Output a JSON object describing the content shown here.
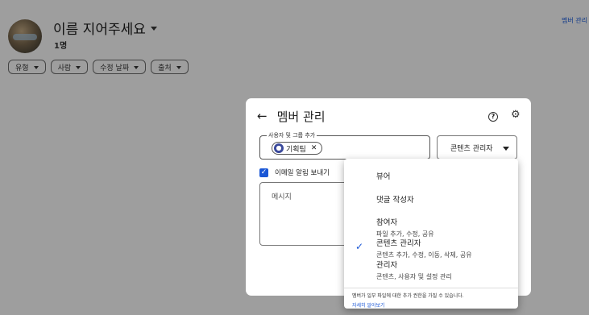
{
  "header": {
    "title": "이름 지어주세요",
    "count": "1명",
    "top_right_link": "멤버 관리"
  },
  "filters": [
    "유형",
    "사람",
    "수정 날짜",
    "출처"
  ],
  "dialog": {
    "title": "멤버 관리",
    "people_field_label": "사용자 및 그룹 추가",
    "person_chip": "기획팀",
    "role_value": "콘텐츠 관리자",
    "notify_label": "이메일 알림 보내기",
    "message_placeholder": "메시지"
  },
  "role_menu": {
    "items": [
      {
        "label": "뷰어",
        "desc": ""
      },
      {
        "label": "댓글 작성자",
        "desc": ""
      },
      {
        "label": "참여자",
        "desc": "파일 추가, 수정, 공유"
      },
      {
        "label": "콘텐츠 관리자",
        "desc": "콘텐츠 추가, 수정, 이동, 삭제, 공유"
      },
      {
        "label": "관리자",
        "desc": "콘텐츠, 사용자 및 설정 관리"
      }
    ],
    "selected_index": 3,
    "footer_text": "멤버가 일부 파일에 대한 추가 권한을 가질 수 있습니다.",
    "footer_link": "자세히 알아보기"
  },
  "colors": {
    "accent": "#1a57d6",
    "scrim": "#9e9e9e"
  }
}
